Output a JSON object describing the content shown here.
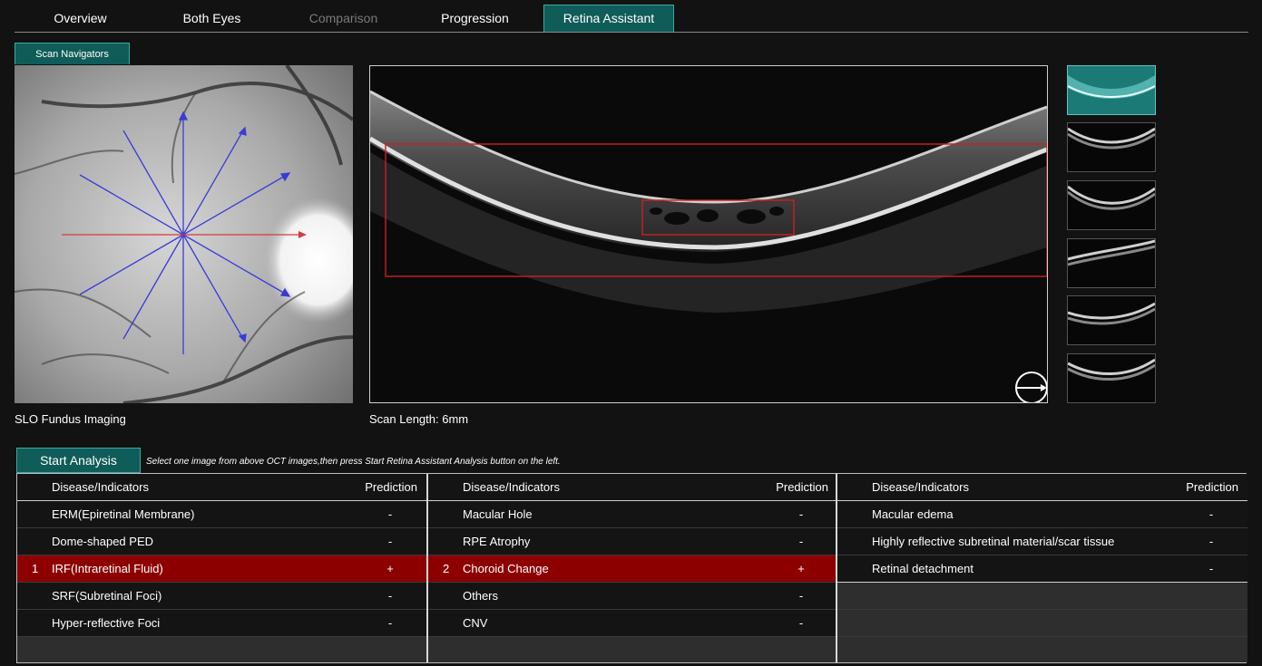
{
  "tabs": [
    {
      "label": "Overview",
      "state": "normal"
    },
    {
      "label": "Both Eyes",
      "state": "normal"
    },
    {
      "label": "Comparison",
      "state": "disabled"
    },
    {
      "label": "Progression",
      "state": "normal"
    },
    {
      "label": "Retina Assistant",
      "state": "active"
    }
  ],
  "subtab": {
    "label": "Scan Navigators"
  },
  "fundus": {
    "caption": "SLO Fundus Imaging"
  },
  "oct": {
    "caption": "Scan Length: 6mm",
    "direction_icon": "arrow-right-circle-icon"
  },
  "analysis": {
    "start_label": "Start Analysis",
    "hint": "Select one image from above OCT images,then press Start Retina Assistant Analysis button on the left."
  },
  "tables": [
    {
      "header": {
        "name": "Disease/Indicators",
        "pred": "Prediction"
      },
      "rows": [
        {
          "num": "",
          "name": "ERM(Epiretinal Membrane)",
          "pred": "-"
        },
        {
          "num": "",
          "name": "Dome-shaped PED",
          "pred": "-"
        },
        {
          "num": "1",
          "name": "IRF(Intraretinal Fluid)",
          "pred": "+"
        },
        {
          "num": "",
          "name": "SRF(Subretinal Foci)",
          "pred": "-"
        },
        {
          "num": "",
          "name": "Hyper-reflective Foci",
          "pred": "-"
        }
      ]
    },
    {
      "header": {
        "name": "Disease/Indicators",
        "pred": "Prediction"
      },
      "rows": [
        {
          "num": "",
          "name": "Macular Hole",
          "pred": "-"
        },
        {
          "num": "",
          "name": "RPE Atrophy",
          "pred": "-"
        },
        {
          "num": "2",
          "name": "Choroid Change",
          "pred": "+"
        },
        {
          "num": "",
          "name": "Others",
          "pred": "-"
        },
        {
          "num": "",
          "name": "CNV",
          "pred": "-"
        }
      ]
    },
    {
      "header": {
        "name": "Disease/Indicators",
        "pred": "Prediction"
      },
      "rows": [
        {
          "num": "",
          "name": "Macular edema",
          "pred": "-"
        },
        {
          "num": "",
          "name": "Highly reflective subretinal material/scar tissue",
          "pred": "-"
        },
        {
          "num": "",
          "name": "Retinal detachment",
          "pred": "-"
        }
      ]
    }
  ],
  "colors": {
    "accent": "#0f5c58",
    "accent_border": "#3ea9a1",
    "highlight": "#8c0000",
    "scan_line": "#3b3bd6",
    "selected_line": "#d63b3b"
  }
}
